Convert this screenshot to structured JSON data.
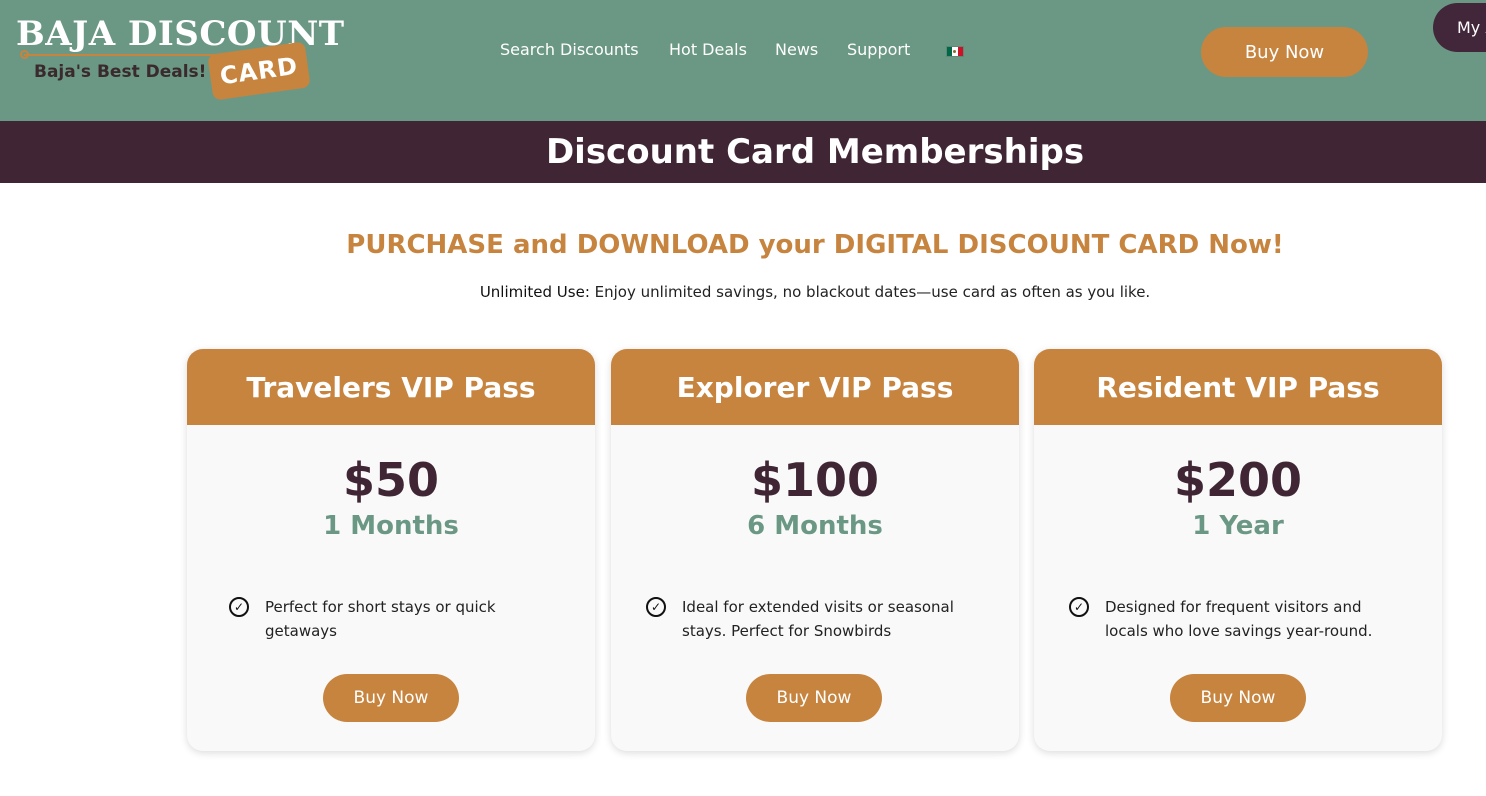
{
  "brand": {
    "name": "BAJA DISCOUNT",
    "card_word": "CARD",
    "tagline": "Baja's Best Deals!"
  },
  "nav": {
    "items": [
      "Search Discounts",
      "Hot Deals",
      "News",
      "Support"
    ],
    "language_flag": "mexico-flag-icon"
  },
  "header": {
    "buy_label": "Buy Now",
    "account_label": "My Account"
  },
  "page": {
    "title": "Discount Card Memberships",
    "headline": "PURCHASE and DOWNLOAD your DIGITAL DISCOUNT CARD Now!",
    "sub_bold": "Unlimited Use:",
    "sub_text": " Enjoy unlimited savings, no blackout dates—use card as often as you like."
  },
  "plans": [
    {
      "name": "Travelers VIP Pass",
      "price": "$50",
      "period": "1 Months",
      "feature": "Perfect for short stays or quick getaways",
      "button": "Buy Now"
    },
    {
      "name": "Explorer VIP Pass",
      "price": "$100",
      "period": "6 Months",
      "feature": "Ideal for extended visits or seasonal stays. Perfect for Snowbirds",
      "button": "Buy Now"
    },
    {
      "name": "Resident VIP Pass",
      "price": "$200",
      "period": "1 Year",
      "feature": "Designed for frequent visitors and locals who love savings year-round.",
      "button": "Buy Now"
    }
  ],
  "colors": {
    "header_green": "#6b9884",
    "accent_orange": "#c6843f",
    "plum": "#402635",
    "card_bg": "#f9f9f9"
  }
}
